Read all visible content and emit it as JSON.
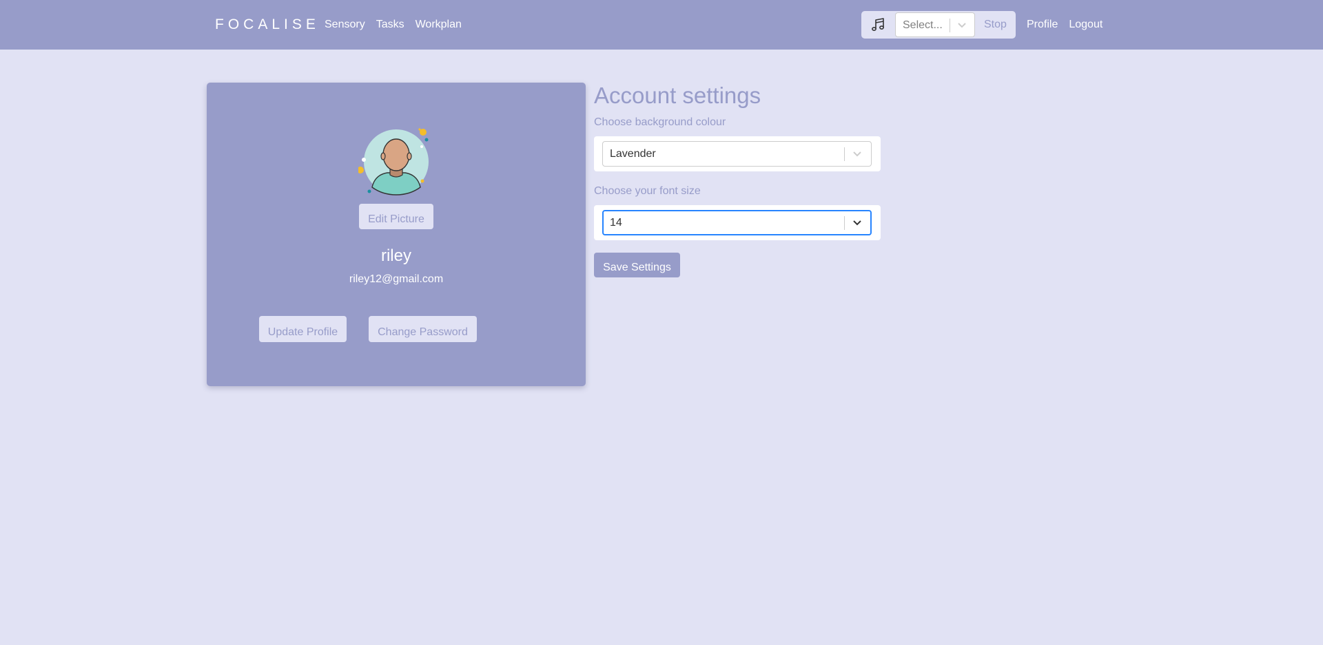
{
  "navbar": {
    "brand": "FOCALISE",
    "links": [
      "Sensory",
      "Tasks",
      "Workplan"
    ],
    "music": {
      "icon": "music-note-icon",
      "select_placeholder": "Select...",
      "stop_label": "Stop"
    },
    "right_links": [
      "Profile",
      "Logout"
    ]
  },
  "profile": {
    "avatar_icon": "user-avatar-illustration",
    "edit_picture_label": "Edit Picture",
    "username": "riley",
    "email": "riley12@gmail.com",
    "update_profile_label": "Update Profile",
    "change_password_label": "Change Password"
  },
  "settings": {
    "title": "Account settings",
    "background_label": "Choose background colour",
    "background_value": "Lavender",
    "font_label": "Choose your font size",
    "font_value": "14",
    "save_label": "Save Settings"
  },
  "colors": {
    "primary": "#979cc9",
    "background": "#e1e2f4",
    "focus": "#2684ff"
  }
}
